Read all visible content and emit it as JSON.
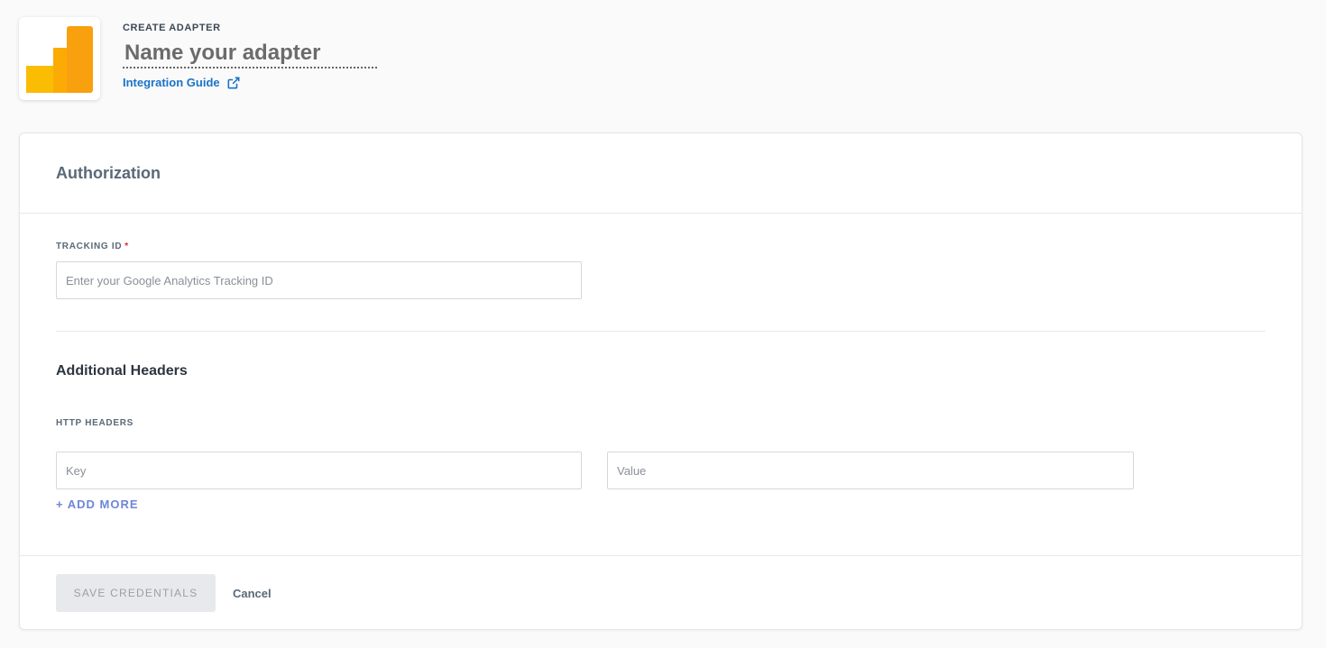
{
  "header": {
    "overline": "CREATE ADAPTER",
    "name_placeholder": "Name your adapter",
    "guide_link": "Integration Guide",
    "brand_colors": [
      "#fbbc04",
      "#f9a00e"
    ]
  },
  "card": {
    "title": "Authorization",
    "tracking": {
      "label": "TRACKING ID",
      "required_mark": "*",
      "placeholder": "Enter your Google Analytics Tracking ID"
    },
    "additional_headers": {
      "title": "Additional Headers",
      "label": "HTTP HEADERS",
      "key_placeholder": "Key",
      "value_placeholder": "Value",
      "add_more": "+ ADD MORE"
    },
    "footer": {
      "save_label": "SAVE CREDENTIALS",
      "cancel_label": "Cancel"
    }
  },
  "colors": {
    "link": "#1a73c8",
    "accent": "#6f86d6",
    "required": "#e02424"
  },
  "icons": [
    "google-analytics-logo",
    "external-link-icon"
  ]
}
